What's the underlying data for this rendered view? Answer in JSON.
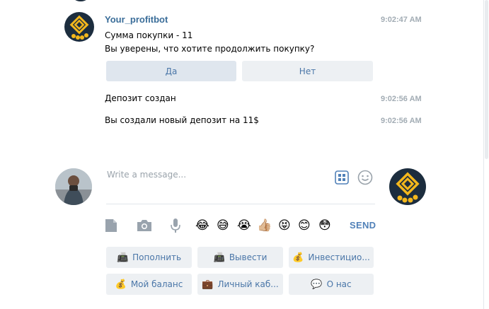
{
  "chat": {
    "messages": [
      {
        "sender": "Your_profitbot",
        "time": "9:02:47 AM",
        "line1": "Сумма покупки - 11",
        "line2": "Вы уверены, что хотите продолжить покупку?"
      },
      {
        "time": "9:02:56 AM",
        "text": "Депозит создан"
      },
      {
        "time": "9:02:56 AM",
        "text": "Вы создали новый депозит на 11$"
      }
    ],
    "inline_buttons": [
      "Да",
      "Нет"
    ]
  },
  "composer": {
    "placeholder": "Write a message...",
    "send_label": "SEND",
    "emojis": [
      "😂",
      "😅",
      "😭",
      "👍🏼",
      "😝",
      "😊",
      "😳"
    ]
  },
  "keyboard": {
    "buttons": [
      {
        "icon": "📠",
        "icon_name": "fax-icon",
        "label": "Пополнить"
      },
      {
        "icon": "📠",
        "icon_name": "fax-icon",
        "label": "Вывести"
      },
      {
        "icon": "💰",
        "icon_name": "money-bag-icon",
        "label": "Инвестицио..."
      },
      {
        "icon": "💰",
        "icon_name": "money-bag-icon",
        "label": "Мой баланс"
      },
      {
        "icon": "💼",
        "icon_name": "briefcase-icon",
        "label": "Личный каб..."
      },
      {
        "icon": "💬",
        "icon_name": "speech-bubble-icon",
        "label": "О нас"
      }
    ]
  },
  "colors": {
    "link": "#4a76a8",
    "sender": "#3a6d99",
    "time": "#a2acb4",
    "button_bg": "#edf0f3",
    "bot_avatar": "#1c2d3e",
    "coin": "#f3b71c"
  }
}
